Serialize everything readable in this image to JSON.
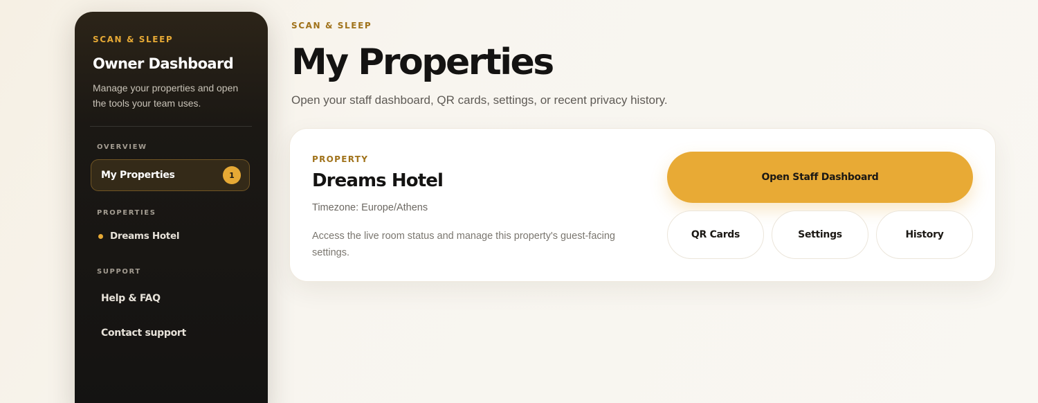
{
  "sidebar": {
    "brand": "SCAN & SLEEP",
    "title": "Owner Dashboard",
    "description": "Manage your properties and open the tools your team uses.",
    "sections": {
      "overview": "OVERVIEW",
      "properties": "PROPERTIES",
      "support": "SUPPORT"
    },
    "active_item": {
      "label": "My Properties",
      "count": "1"
    },
    "property_item": "Dreams Hotel",
    "support_links": [
      "Help & FAQ",
      "Contact support"
    ]
  },
  "header": {
    "brand": "SCAN & SLEEP",
    "title": "My Properties",
    "subtitle": "Open your staff dashboard, QR cards, settings, or recent privacy history."
  },
  "property_card": {
    "eyebrow": "PROPERTY",
    "name": "Dreams Hotel",
    "timezone": "Timezone: Europe/Athens",
    "description": "Access the live room status and manage this property's guest-facing settings.",
    "primary_action": "Open Staff Dashboard",
    "secondary_actions": [
      "QR Cards",
      "Settings",
      "History"
    ]
  },
  "colors": {
    "accent": "#e8aa35",
    "sidebar_bg": "#141312",
    "eyebrow": "#a0721a"
  }
}
